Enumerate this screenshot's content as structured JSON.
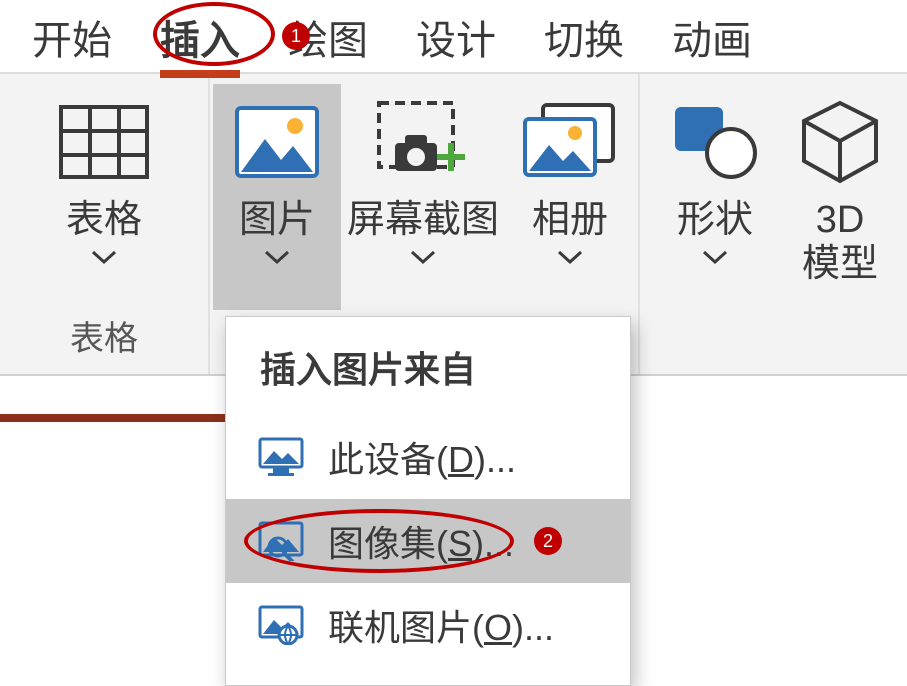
{
  "tabs": {
    "t0": "开始",
    "t1": "插入",
    "t2": "绘图",
    "t3": "设计",
    "t4": "切换",
    "t5": "动画"
  },
  "ribbon": {
    "table_btn": "表格",
    "table_group": "表格",
    "picture_btn": "图片",
    "screenshot_btn": "屏幕截图",
    "album_btn": "相册",
    "shapes_btn": "形状",
    "model3d_line1": "3D",
    "model3d_line2": "模型"
  },
  "menu": {
    "title": "插入图片来自",
    "item_device_prefix": "此设备(",
    "item_device_key": "D",
    "item_device_suffix": ")...",
    "item_stock_prefix": "图像集(",
    "item_stock_key": "S",
    "item_stock_suffix": ")...",
    "item_online_prefix": "联机图片(",
    "item_online_key": "O",
    "item_online_suffix": ")..."
  },
  "callouts": {
    "n1": "1",
    "n2": "2"
  }
}
